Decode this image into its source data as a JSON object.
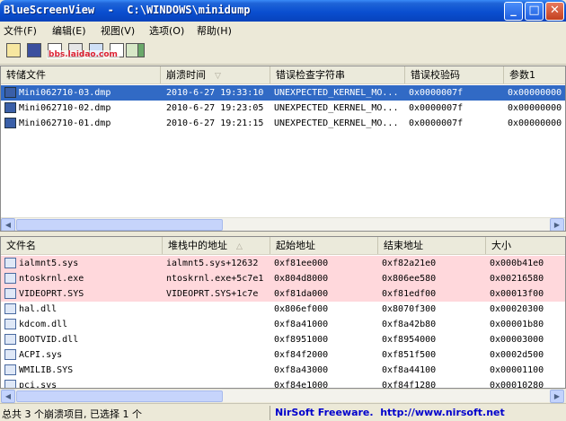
{
  "window": {
    "title": "BlueScreenView  -  C:\\WINDOWS\\minidump",
    "min_glyph": "_",
    "max_glyph": "□",
    "close_glyph": "✕"
  },
  "menu": {
    "items": [
      {
        "label": "文件(F)"
      },
      {
        "label": "编辑(E)"
      },
      {
        "label": "视图(V)"
      },
      {
        "label": "选项(O)"
      },
      {
        "label": "帮助(H)"
      }
    ]
  },
  "toolbar": {
    "icons": [
      "open-icon",
      "save-icon",
      "copy-icon",
      "properties-icon",
      "html-report-icon",
      "find-icon",
      "refresh-icon",
      "exit-icon"
    ],
    "watermark": "bbs.laidao.com"
  },
  "crash_list": {
    "columns": [
      "转储文件",
      "崩溃时间",
      "错误检查字符串",
      "错误校验码",
      "参数1"
    ],
    "sort_indicator": "▽",
    "rows": [
      {
        "file": "Mini062710-03.dmp",
        "time": "2010-6-27  19:33:10",
        "bugcheck_string": "UNEXPECTED_KERNEL_MO...",
        "bugcheck_code": "0x0000007f",
        "param1": "0x00000000",
        "selected": true
      },
      {
        "file": "Mini062710-02.dmp",
        "time": "2010-6-27  19:23:05",
        "bugcheck_string": "UNEXPECTED_KERNEL_MO...",
        "bugcheck_code": "0x0000007f",
        "param1": "0x00000000",
        "selected": false
      },
      {
        "file": "Mini062710-01.dmp",
        "time": "2010-6-27  19:21:15",
        "bugcheck_string": "UNEXPECTED_KERNEL_MO...",
        "bugcheck_code": "0x0000007f",
        "param1": "0x00000000",
        "selected": false
      }
    ]
  },
  "driver_list": {
    "columns": [
      "文件名",
      "堆栈中的地址",
      "起始地址",
      "结束地址",
      "大小"
    ],
    "sort_indicator": "△",
    "rows": [
      {
        "name": "ialmnt5.sys",
        "stack_address": "ialmnt5.sys+12632",
        "start": "0xf81ee000",
        "end": "0xf82a21e0",
        "size": "0x000b41e0",
        "highlight": true
      },
      {
        "name": "ntoskrnl.exe",
        "stack_address": "ntoskrnl.exe+5c7e1",
        "start": "0x804d8000",
        "end": "0x806ee580",
        "size": "0x00216580",
        "highlight": true
      },
      {
        "name": "VIDEOPRT.SYS",
        "stack_address": "VIDEOPRT.SYS+1c7e",
        "start": "0xf81da000",
        "end": "0xf81edf00",
        "size": "0x00013f00",
        "highlight": true
      },
      {
        "name": "hal.dll",
        "stack_address": "",
        "start": "0x806ef000",
        "end": "0x8070f300",
        "size": "0x00020300",
        "highlight": false
      },
      {
        "name": "kdcom.dll",
        "stack_address": "",
        "start": "0xf8a41000",
        "end": "0xf8a42b80",
        "size": "0x00001b80",
        "highlight": false
      },
      {
        "name": "BOOTVID.dll",
        "stack_address": "",
        "start": "0xf8951000",
        "end": "0xf8954000",
        "size": "0x00003000",
        "highlight": false
      },
      {
        "name": "ACPI.sys",
        "stack_address": "",
        "start": "0xf84f2000",
        "end": "0xf851f500",
        "size": "0x0002d500",
        "highlight": false
      },
      {
        "name": "WMILIB.SYS",
        "stack_address": "",
        "start": "0xf8a43000",
        "end": "0xf8a44100",
        "size": "0x00001100",
        "highlight": false
      },
      {
        "name": "pci.sys",
        "stack_address": "",
        "start": "0xf84e1000",
        "end": "0xf84f1280",
        "size": "0x00010280",
        "highlight": false
      }
    ]
  },
  "status": {
    "summary": "总共 3 个崩溃项目, 已选择 1 个",
    "credit": "NirSoft Freeware.  http://www.nirsoft.net"
  },
  "colors": {
    "titlebar": "#0a4fd0",
    "selection": "#316ac5",
    "highlight_row": "#ffd8dc",
    "link": "#0000cc"
  }
}
